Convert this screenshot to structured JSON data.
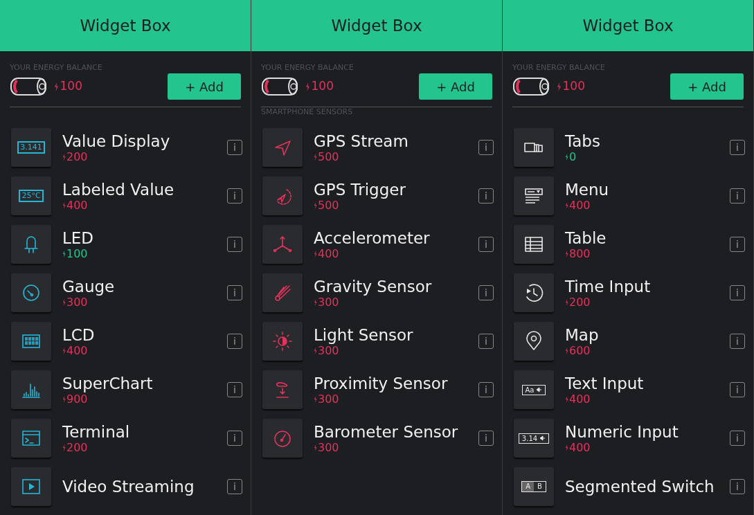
{
  "panels": [
    {
      "title": "Widget Box",
      "balance_label": "YOUR ENERGY BALANCE",
      "balance": "100",
      "add_button": "+ Add",
      "items": [
        {
          "name": "Value Display",
          "price": "200",
          "affordable": false,
          "kind": "value-display",
          "icon_text": "3.141",
          "info": "i"
        },
        {
          "name": "Labeled Value",
          "price": "400",
          "affordable": false,
          "kind": "value-display",
          "icon_text": "25°C",
          "info": "i"
        },
        {
          "name": "LED",
          "price": "100",
          "affordable": true,
          "kind": "led",
          "info": "i"
        },
        {
          "name": "Gauge",
          "price": "300",
          "affordable": false,
          "kind": "gauge",
          "info": "i"
        },
        {
          "name": "LCD",
          "price": "400",
          "affordable": false,
          "kind": "lcd",
          "info": "i"
        },
        {
          "name": "SuperChart",
          "price": "900",
          "affordable": false,
          "kind": "chart",
          "info": "i"
        },
        {
          "name": "Terminal",
          "price": "200",
          "affordable": false,
          "kind": "terminal",
          "info": "i"
        },
        {
          "name": "Video Streaming",
          "kind": "video",
          "info": "i"
        }
      ]
    },
    {
      "title": "Widget Box",
      "balance_label": "YOUR ENERGY BALANCE",
      "balance": "100",
      "add_button": "+ Add",
      "section": "SMARTPHONE SENSORS",
      "items": [
        {
          "name": "GPS Stream",
          "price": "500",
          "affordable": false,
          "kind": "gps",
          "info": "i"
        },
        {
          "name": "GPS Trigger",
          "price": "500",
          "affordable": false,
          "kind": "gps-trigger",
          "info": "i"
        },
        {
          "name": "Accelerometer",
          "price": "400",
          "affordable": false,
          "kind": "axes",
          "info": "i"
        },
        {
          "name": "Gravity Sensor",
          "price": "300",
          "affordable": false,
          "kind": "comet",
          "info": "i"
        },
        {
          "name": "Light Sensor",
          "price": "300",
          "affordable": false,
          "kind": "sun",
          "info": "i"
        },
        {
          "name": "Proximity Sensor",
          "price": "300",
          "affordable": false,
          "kind": "hand",
          "info": "i"
        },
        {
          "name": "Barometer Sensor",
          "price": "300",
          "affordable": false,
          "kind": "barometer",
          "info": "i"
        }
      ]
    },
    {
      "title": "Widget Box",
      "balance_label": "YOUR ENERGY BALANCE",
      "balance": "100",
      "add_button": "+ Add",
      "items": [
        {
          "name": "Tabs",
          "price": "0",
          "affordable": true,
          "kind": "tabs",
          "info": "i"
        },
        {
          "name": "Menu",
          "price": "400",
          "affordable": false,
          "kind": "menu",
          "info": "i"
        },
        {
          "name": "Table",
          "price": "800",
          "affordable": false,
          "kind": "table",
          "info": "i"
        },
        {
          "name": "Time Input",
          "price": "200",
          "affordable": false,
          "kind": "clock",
          "info": "i"
        },
        {
          "name": "Map",
          "price": "600",
          "affordable": false,
          "kind": "pin",
          "info": "i"
        },
        {
          "name": "Text Input",
          "price": "400",
          "affordable": false,
          "kind": "input",
          "icon_text": "Aa",
          "info": "i"
        },
        {
          "name": "Numeric Input",
          "price": "400",
          "affordable": false,
          "kind": "input",
          "icon_text": "3.14",
          "info": "i"
        },
        {
          "name": "Segmented Switch",
          "kind": "segmented",
          "icon_text": "A",
          "icon_text_2": "B",
          "info": "i"
        }
      ]
    }
  ]
}
